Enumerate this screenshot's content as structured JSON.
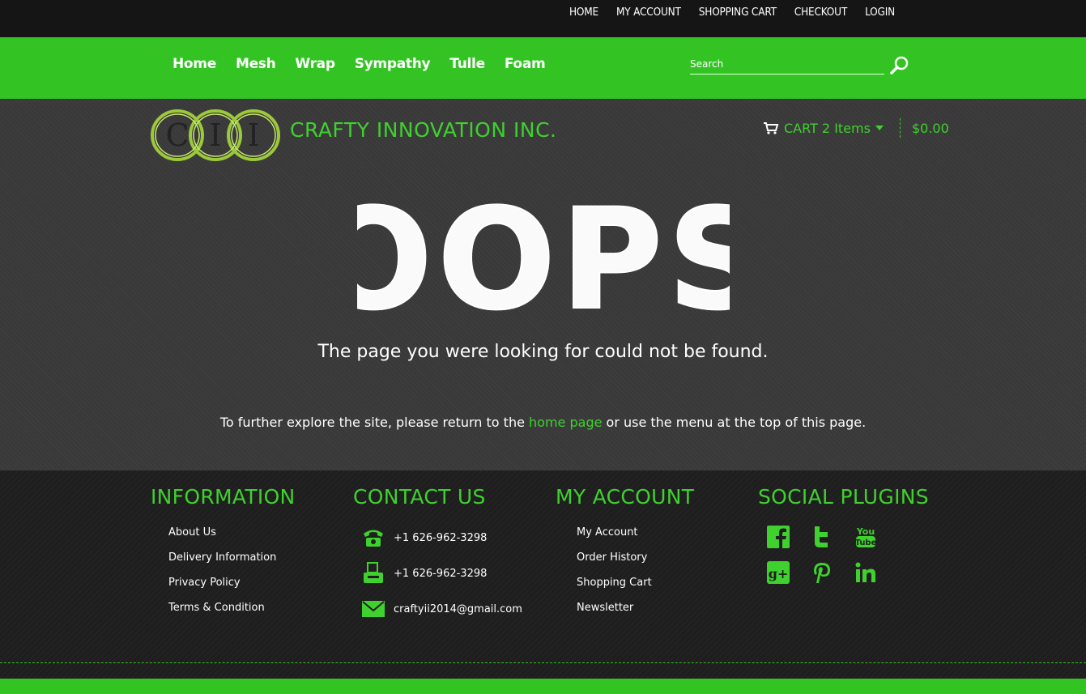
{
  "topbar": {
    "links": [
      "HOME",
      "MY ACCOUNT",
      "SHOPPING CART",
      "CHECKOUT",
      "LOGIN"
    ]
  },
  "nav": {
    "items": [
      "Home",
      "Mesh",
      "Wrap",
      "Sympathy",
      "Tulle",
      "Foam"
    ],
    "search_placeholder": "Search"
  },
  "header": {
    "logo_text": "CII",
    "brand": "CRAFTY INNOVATION INC.",
    "cart_label": "CART 2 Items",
    "cart_total": "$0.00"
  },
  "error": {
    "heading": "OOPS",
    "message": "The page you were looking for could not be found.",
    "explore_before": "To further explore the site, please return to the ",
    "explore_link": "home page",
    "explore_after": " or use the menu at the top of this page."
  },
  "footer": {
    "information": {
      "title": "INFORMATION",
      "links": [
        "About Us",
        "Delivery Information",
        "Privacy Policy",
        "Terms & Condition"
      ]
    },
    "contact": {
      "title": "CONTACT US",
      "phone": "+1 626-962-3298",
      "fax": "+1 626-962-3298",
      "email": "craftyii2014@gmail.com"
    },
    "account": {
      "title": "MY ACCOUNT",
      "links": [
        "My Account",
        "Order History",
        "Shopping Cart",
        "Newsletter"
      ]
    },
    "social": {
      "title": "SOCIAL PLUGINS",
      "icons": [
        "facebook-icon",
        "twitter-icon",
        "youtube-icon",
        "google-plus-icon",
        "pinterest-icon",
        "linkedin-icon"
      ]
    }
  },
  "colors": {
    "accent": "#33c424",
    "accent_text": "#3fd12e",
    "topbar": "#151515",
    "main_bg": "#393939",
    "footer_bg": "#1e1e1e"
  }
}
